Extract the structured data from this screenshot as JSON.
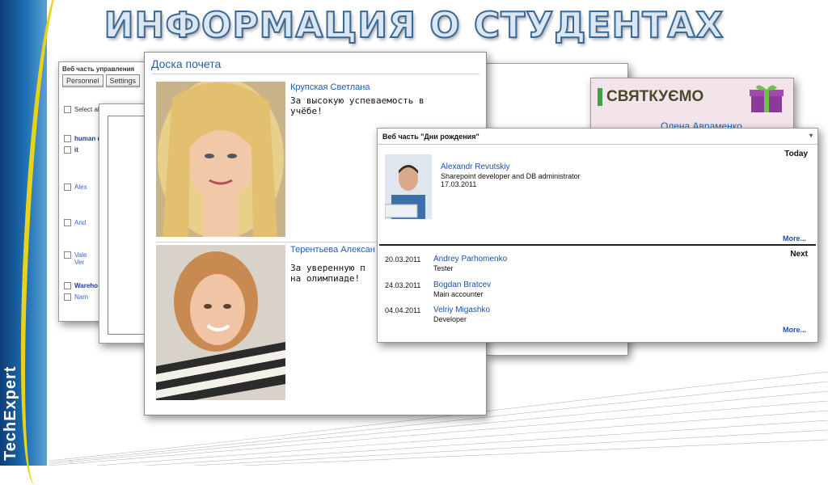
{
  "slide": {
    "title": "ИНФОРМАЦИЯ О СТУДЕНТАХ",
    "brand": "TechExpert"
  },
  "admin_panel": {
    "header": "Веб часть управления",
    "tabs": [
      "Personnel",
      "Settings"
    ],
    "select_all": "Select all",
    "groups": [
      "human r",
      "it",
      "Wareho"
    ],
    "rows": [
      "Alex",
      "And",
      "Vale",
      "Ver",
      "Nam"
    ]
  },
  "honor_board": {
    "title": "Доска почета",
    "entries": [
      {
        "name": "Крупская Светлана",
        "description": "За высокую успеваемость в\nучёбе!"
      },
      {
        "name": "Терентьева Алексан",
        "description": "За уверенную п\nна олимпиаде!"
      }
    ]
  },
  "holiday_banner": {
    "text": "СВЯТКУЄМО",
    "name": "Олена Авраменко"
  },
  "birthdays": {
    "header": "Веб часть \"Дни рождения\"",
    "today_label": "Today",
    "next_label": "Next",
    "more_label": "More...",
    "today": {
      "name": "Alexandr Revutskiy",
      "role": "Sharepoint developer and DB administrator",
      "date": "17.03.2011"
    },
    "upcoming": [
      {
        "date": "20.03.2011",
        "name": "Andrey Parhomenko",
        "role": "Tester"
      },
      {
        "date": "24.03.2011",
        "name": "Bogdan Bratcev",
        "role": "Main accounter"
      },
      {
        "date": "04.04.2011",
        "name": "Velriy Migashko",
        "role": "Developer"
      }
    ]
  }
}
